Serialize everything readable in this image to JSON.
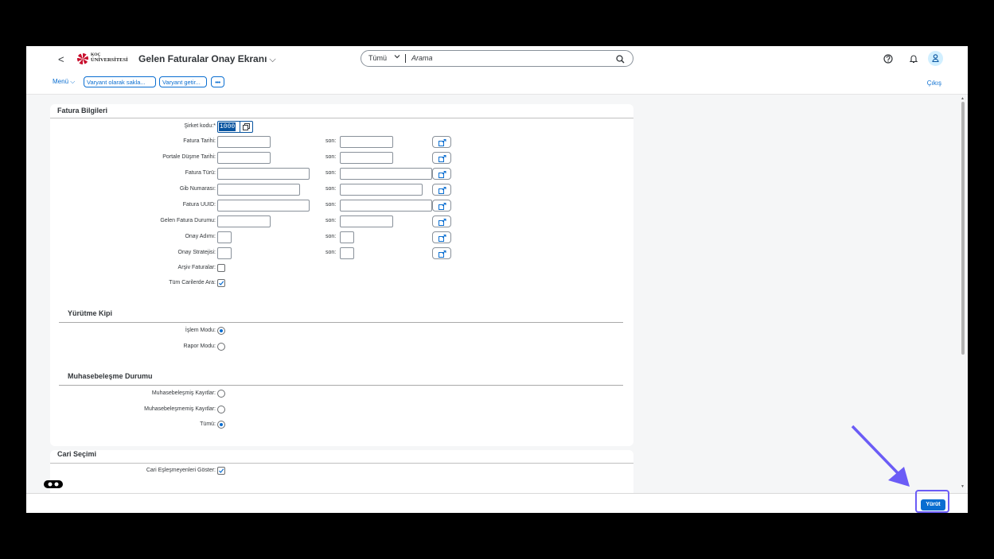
{
  "shell": {
    "back": "<",
    "logo_line1": "KOÇ",
    "logo_line2": "ÜNİVERSİTESİ",
    "app_title": "Gelen Faturalar Onay Ekranı",
    "search_scope": "Tümü",
    "search_placeholder": "Arama"
  },
  "toolbar": {
    "menu": "Menü",
    "save_variant": "Varyant olarak sakla...",
    "get_variant": "Varyant getir...",
    "more": "•••",
    "exit": "Çıkış"
  },
  "fatura": {
    "title": "Fatura Bilgileri",
    "sirket_label": "Şirket kodu:*",
    "sirket_value": "1000",
    "son_label": "son:",
    "rows": [
      {
        "label": "Fatura Tarihi:"
      },
      {
        "label": "Portale Düşme Tarihi:"
      },
      {
        "label": "Fatura Türü:"
      },
      {
        "label": "Gib Numarası:"
      },
      {
        "label": "Fatura UUID:"
      },
      {
        "label": "Gelen Fatura Durumu:"
      },
      {
        "label": "Onay Adımı:"
      },
      {
        "label": "Onay Stratejisi:"
      }
    ],
    "arsiv_label": "Arşiv Faturalar:",
    "arsiv_checked": false,
    "tum_label": "Tüm Carilerde Ara:",
    "tum_checked": true
  },
  "yurutme": {
    "title": "Yürütme Kipi",
    "islem_label": "İşlem Modu:",
    "rapor_label": "Rapor Modu:",
    "selected": "islem"
  },
  "muhasebe": {
    "title": "Muhasebeleşme Durumu",
    "kayitli_label": "Muhasebeleşmiş Kayıtlar:",
    "kayitsiz_label": "Muhasebeleşmemiş Kayıtlar:",
    "tumu_label": "Tümü:",
    "selected": "tumu"
  },
  "cari": {
    "title": "Cari Seçimi",
    "goster_label": "Cari Eşleşmeyenleri Göster:",
    "goster_checked": true
  },
  "footer": {
    "execute": "Yürüt"
  },
  "colors": {
    "accent": "#0a6ed1",
    "highlight": "#6b5cf6"
  }
}
